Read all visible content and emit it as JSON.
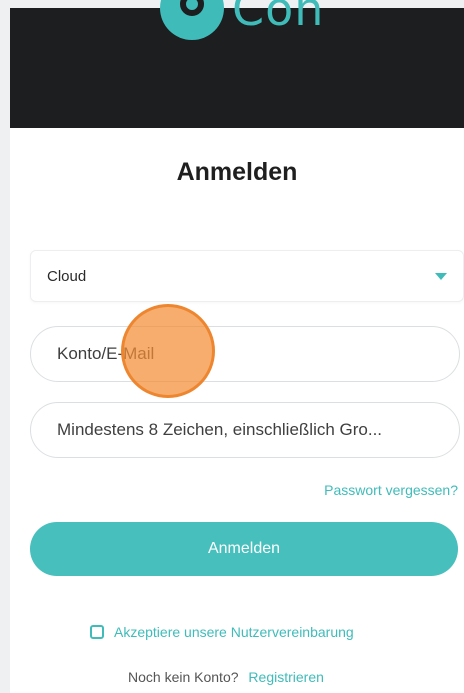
{
  "header": {
    "logo_text": "Con",
    "bg_color": "#1c1e1f",
    "brand_color": "#3fbcba"
  },
  "form": {
    "title": "Anmelden",
    "region": {
      "value": "Cloud"
    },
    "account": {
      "placeholder": "Konto/E-Mail"
    },
    "password": {
      "placeholder": "Mindestens 8 Zeichen, einschließlich Gro..."
    },
    "forgot_label": "Passwort vergessen?",
    "submit_label": "Anmelden",
    "agreement_label": "Akzeptiere unsere Nutzervereinbarung",
    "no_account_label": "Noch kein Konto?",
    "register_label": "Registrieren"
  },
  "overlay": {
    "touch_color": "#f38e34"
  }
}
